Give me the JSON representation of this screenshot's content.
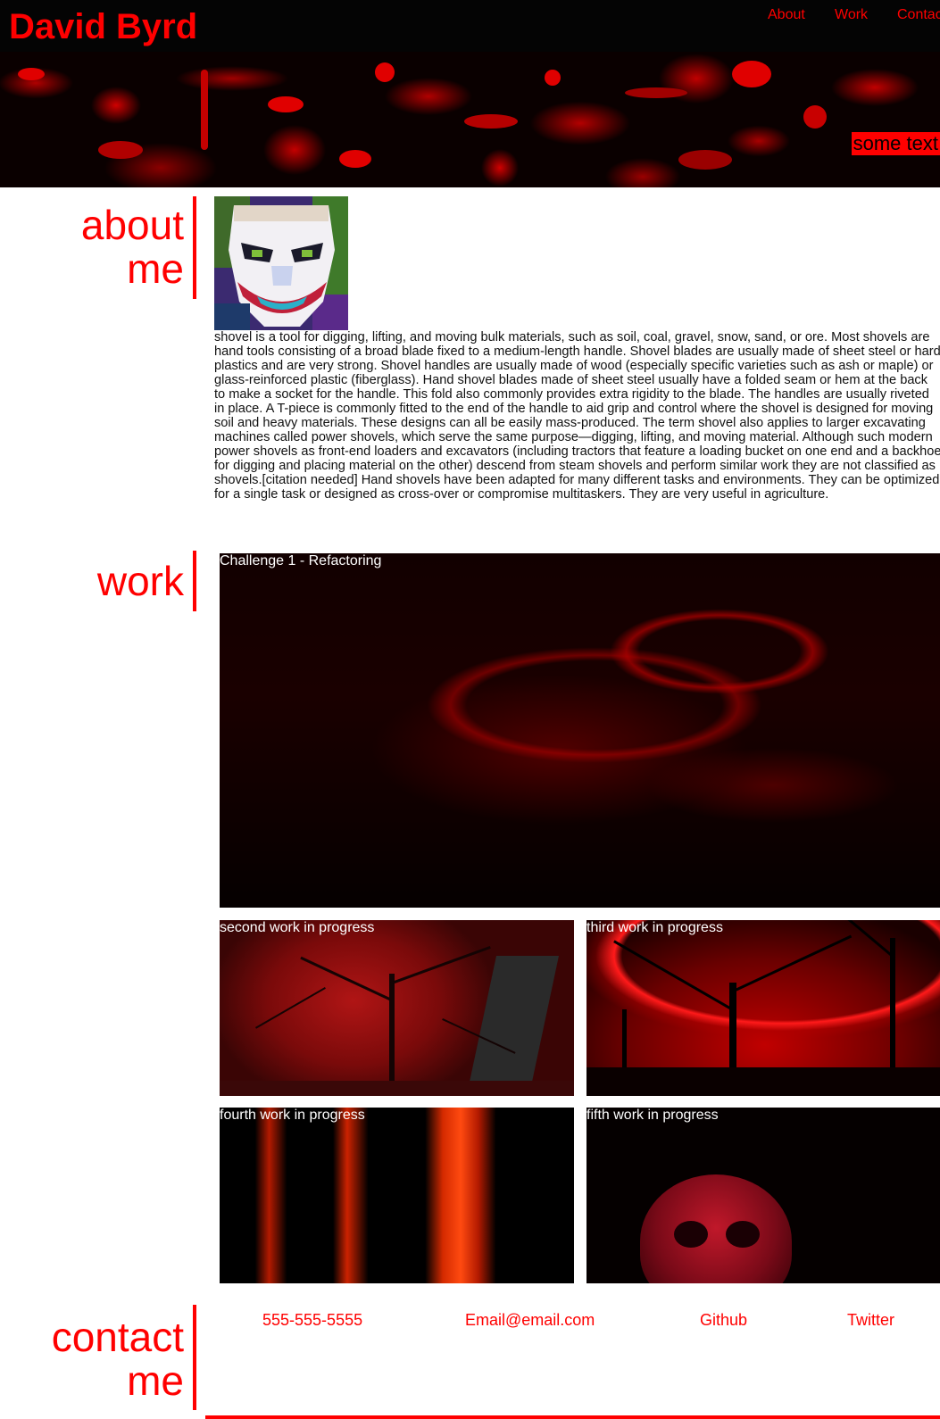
{
  "header": {
    "site_title": "David Byrd",
    "nav": [
      "About",
      "Work",
      "Contact"
    ],
    "hero_tag": "some text"
  },
  "about": {
    "heading": "about me",
    "heading_line1": "about",
    "heading_line2": "me",
    "bio": "shovel is a tool for digging, lifting, and moving bulk materials, such as soil, coal, gravel, snow, sand, or ore. Most shovels are hand tools consisting of a broad blade fixed to a medium-length handle. Shovel blades are usually made of sheet steel or hard plastics and are very strong. Shovel handles are usually made of wood (especially specific varieties such as ash or maple) or glass-reinforced plastic (fiberglass). Hand shovel blades made of sheet steel usually have a folded seam or hem at the back to make a socket for the handle. This fold also commonly provides extra rigidity to the blade. The handles are usually riveted in place. A T-piece is commonly fitted to the end of the handle to aid grip and control where the shovel is designed for moving soil and heavy materials. These designs can all be easily mass-produced. The term shovel also applies to larger excavating machines called power shovels, which serve the same purpose—digging, lifting, and moving material. Although such modern power shovels as front-end loaders and excavators (including tractors that feature a loading bucket on one end and a backhoe for digging and placing material on the other) descend from steam shovels and perform similar work they are not classified as shovels.[citation needed] Hand shovels have been adapted for many different tasks and environments. They can be optimized for a single task or designed as cross-over or compromise multitaskers. They are very useful in agriculture."
  },
  "work": {
    "heading": "work",
    "items": [
      {
        "caption": "Challenge 1 - Refactoring"
      },
      {
        "caption": "second work in progress"
      },
      {
        "caption": "third work in progress"
      },
      {
        "caption": "fourth work in progress"
      },
      {
        "caption": "fifth work in progress"
      }
    ]
  },
  "contact": {
    "heading_line1": "contact",
    "heading_line2": "me",
    "links": [
      "555-555-5555",
      "Email@email.com",
      "Github",
      "Twitter"
    ]
  },
  "colors": {
    "accent": "#ff0000",
    "header_bg": "#040404",
    "text": "#111111"
  }
}
